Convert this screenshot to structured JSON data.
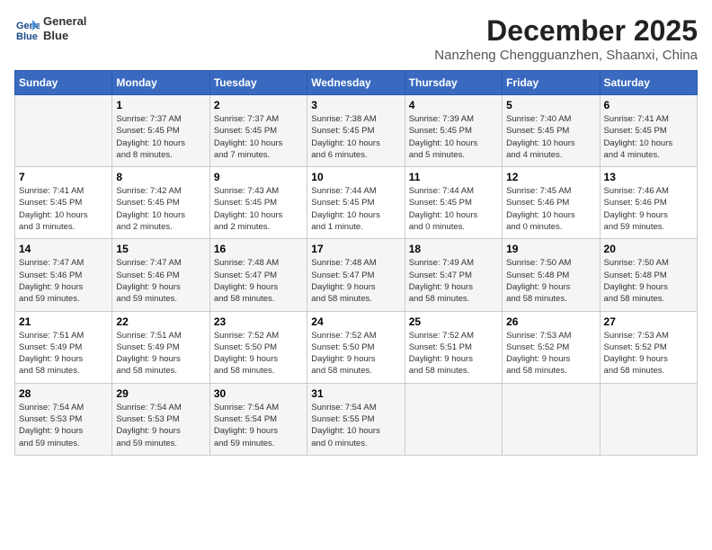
{
  "header": {
    "logo_line1": "General",
    "logo_line2": "Blue",
    "month": "December 2025",
    "location": "Nanzheng Chengguanzhen, Shaanxi, China"
  },
  "columns": [
    "Sunday",
    "Monday",
    "Tuesday",
    "Wednesday",
    "Thursday",
    "Friday",
    "Saturday"
  ],
  "weeks": [
    [
      {
        "day": "",
        "info": ""
      },
      {
        "day": "1",
        "info": "Sunrise: 7:37 AM\nSunset: 5:45 PM\nDaylight: 10 hours\nand 8 minutes."
      },
      {
        "day": "2",
        "info": "Sunrise: 7:37 AM\nSunset: 5:45 PM\nDaylight: 10 hours\nand 7 minutes."
      },
      {
        "day": "3",
        "info": "Sunrise: 7:38 AM\nSunset: 5:45 PM\nDaylight: 10 hours\nand 6 minutes."
      },
      {
        "day": "4",
        "info": "Sunrise: 7:39 AM\nSunset: 5:45 PM\nDaylight: 10 hours\nand 5 minutes."
      },
      {
        "day": "5",
        "info": "Sunrise: 7:40 AM\nSunset: 5:45 PM\nDaylight: 10 hours\nand 4 minutes."
      },
      {
        "day": "6",
        "info": "Sunrise: 7:41 AM\nSunset: 5:45 PM\nDaylight: 10 hours\nand 4 minutes."
      }
    ],
    [
      {
        "day": "7",
        "info": "Sunrise: 7:41 AM\nSunset: 5:45 PM\nDaylight: 10 hours\nand 3 minutes."
      },
      {
        "day": "8",
        "info": "Sunrise: 7:42 AM\nSunset: 5:45 PM\nDaylight: 10 hours\nand 2 minutes."
      },
      {
        "day": "9",
        "info": "Sunrise: 7:43 AM\nSunset: 5:45 PM\nDaylight: 10 hours\nand 2 minutes."
      },
      {
        "day": "10",
        "info": "Sunrise: 7:44 AM\nSunset: 5:45 PM\nDaylight: 10 hours\nand 1 minute."
      },
      {
        "day": "11",
        "info": "Sunrise: 7:44 AM\nSunset: 5:45 PM\nDaylight: 10 hours\nand 0 minutes."
      },
      {
        "day": "12",
        "info": "Sunrise: 7:45 AM\nSunset: 5:46 PM\nDaylight: 10 hours\nand 0 minutes."
      },
      {
        "day": "13",
        "info": "Sunrise: 7:46 AM\nSunset: 5:46 PM\nDaylight: 9 hours\nand 59 minutes."
      }
    ],
    [
      {
        "day": "14",
        "info": "Sunrise: 7:47 AM\nSunset: 5:46 PM\nDaylight: 9 hours\nand 59 minutes."
      },
      {
        "day": "15",
        "info": "Sunrise: 7:47 AM\nSunset: 5:46 PM\nDaylight: 9 hours\nand 59 minutes."
      },
      {
        "day": "16",
        "info": "Sunrise: 7:48 AM\nSunset: 5:47 PM\nDaylight: 9 hours\nand 58 minutes."
      },
      {
        "day": "17",
        "info": "Sunrise: 7:48 AM\nSunset: 5:47 PM\nDaylight: 9 hours\nand 58 minutes."
      },
      {
        "day": "18",
        "info": "Sunrise: 7:49 AM\nSunset: 5:47 PM\nDaylight: 9 hours\nand 58 minutes."
      },
      {
        "day": "19",
        "info": "Sunrise: 7:50 AM\nSunset: 5:48 PM\nDaylight: 9 hours\nand 58 minutes."
      },
      {
        "day": "20",
        "info": "Sunrise: 7:50 AM\nSunset: 5:48 PM\nDaylight: 9 hours\nand 58 minutes."
      }
    ],
    [
      {
        "day": "21",
        "info": "Sunrise: 7:51 AM\nSunset: 5:49 PM\nDaylight: 9 hours\nand 58 minutes."
      },
      {
        "day": "22",
        "info": "Sunrise: 7:51 AM\nSunset: 5:49 PM\nDaylight: 9 hours\nand 58 minutes."
      },
      {
        "day": "23",
        "info": "Sunrise: 7:52 AM\nSunset: 5:50 PM\nDaylight: 9 hours\nand 58 minutes."
      },
      {
        "day": "24",
        "info": "Sunrise: 7:52 AM\nSunset: 5:50 PM\nDaylight: 9 hours\nand 58 minutes."
      },
      {
        "day": "25",
        "info": "Sunrise: 7:52 AM\nSunset: 5:51 PM\nDaylight: 9 hours\nand 58 minutes."
      },
      {
        "day": "26",
        "info": "Sunrise: 7:53 AM\nSunset: 5:52 PM\nDaylight: 9 hours\nand 58 minutes."
      },
      {
        "day": "27",
        "info": "Sunrise: 7:53 AM\nSunset: 5:52 PM\nDaylight: 9 hours\nand 58 minutes."
      }
    ],
    [
      {
        "day": "28",
        "info": "Sunrise: 7:54 AM\nSunset: 5:53 PM\nDaylight: 9 hours\nand 59 minutes."
      },
      {
        "day": "29",
        "info": "Sunrise: 7:54 AM\nSunset: 5:53 PM\nDaylight: 9 hours\nand 59 minutes."
      },
      {
        "day": "30",
        "info": "Sunrise: 7:54 AM\nSunset: 5:54 PM\nDaylight: 9 hours\nand 59 minutes."
      },
      {
        "day": "31",
        "info": "Sunrise: 7:54 AM\nSunset: 5:55 PM\nDaylight: 10 hours\nand 0 minutes."
      },
      {
        "day": "",
        "info": ""
      },
      {
        "day": "",
        "info": ""
      },
      {
        "day": "",
        "info": ""
      }
    ]
  ]
}
